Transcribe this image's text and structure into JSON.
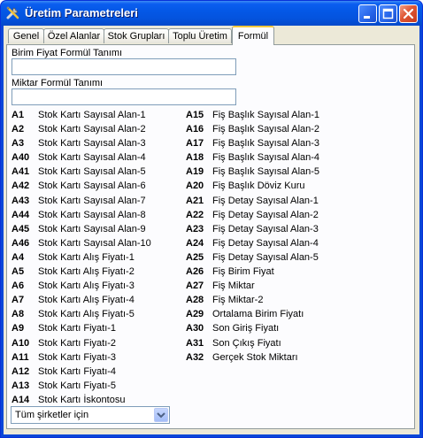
{
  "window": {
    "title": "Üretim Parametreleri",
    "app_icon": "tools-icon",
    "colors": {
      "titlebar": "#0458e6",
      "face": "#ece9d8",
      "tab_highlight": "#ffc83c",
      "close": "#df5633"
    }
  },
  "tabs": [
    {
      "label": "Genel"
    },
    {
      "label": "Özel Alanlar"
    },
    {
      "label": "Stok Grupları"
    },
    {
      "label": "Toplu Üretim"
    },
    {
      "label": "Formül",
      "active": true
    }
  ],
  "form": {
    "unit_price_label": "Birim Fiyat Formül Tanımı",
    "unit_price_value": "",
    "quantity_label": "Miktar Formül Tanımı",
    "quantity_value": ""
  },
  "left_codes": [
    {
      "code": "A1",
      "desc": "Stok Kartı Sayısal Alan-1"
    },
    {
      "code": "A2",
      "desc": "Stok Kartı Sayısal Alan-2"
    },
    {
      "code": "A3",
      "desc": "Stok Kartı Sayısal Alan-3"
    },
    {
      "code": "A40",
      "desc": "Stok Kartı Sayısal Alan-4"
    },
    {
      "code": "A41",
      "desc": "Stok Kartı Sayısal Alan-5"
    },
    {
      "code": "A42",
      "desc": "Stok Kartı Sayısal Alan-6"
    },
    {
      "code": "A43",
      "desc": "Stok Kartı Sayısal Alan-7"
    },
    {
      "code": "A44",
      "desc": "Stok Kartı Sayısal Alan-8"
    },
    {
      "code": "A45",
      "desc": "Stok Kartı Sayısal Alan-9"
    },
    {
      "code": "A46",
      "desc": "Stok Kartı Sayısal Alan-10"
    },
    {
      "code": "A4",
      "desc": "Stok Kartı Alış Fiyatı-1"
    },
    {
      "code": "A5",
      "desc": "Stok Kartı Alış Fiyatı-2"
    },
    {
      "code": "A6",
      "desc": "Stok Kartı Alış Fiyatı-3"
    },
    {
      "code": "A7",
      "desc": "Stok Kartı Alış Fiyatı-4"
    },
    {
      "code": "A8",
      "desc": "Stok Kartı Alış Fiyatı-5"
    },
    {
      "code": "A9",
      "desc": "Stok Kartı Fiyatı-1"
    },
    {
      "code": "A10",
      "desc": "Stok Kartı Fiyatı-2"
    },
    {
      "code": "A11",
      "desc": "Stok Kartı Fiyatı-3"
    },
    {
      "code": "A12",
      "desc": "Stok Kartı Fiyatı-4"
    },
    {
      "code": "A13",
      "desc": "Stok Kartı Fiyatı-5"
    },
    {
      "code": "A14",
      "desc": "Stok Kartı İskontosu"
    }
  ],
  "right_codes": [
    {
      "code": "A15",
      "desc": "Fiş Başlık Sayısal Alan-1"
    },
    {
      "code": "A16",
      "desc": "Fiş Başlık Sayısal Alan-2"
    },
    {
      "code": "A17",
      "desc": "Fiş Başlık Sayısal Alan-3"
    },
    {
      "code": "A18",
      "desc": "Fiş Başlık Sayısal Alan-4"
    },
    {
      "code": "A19",
      "desc": "Fiş Başlık Sayısal Alan-5"
    },
    {
      "code": "A20",
      "desc": "Fiş Başlık Döviz Kuru"
    },
    {
      "code": "A21",
      "desc": "Fiş Detay Sayısal Alan-1"
    },
    {
      "code": "A22",
      "desc": "Fiş Detay Sayısal Alan-2"
    },
    {
      "code": "A23",
      "desc": "Fiş Detay Sayısal Alan-3"
    },
    {
      "code": "A24",
      "desc": "Fiş Detay Sayısal Alan-4"
    },
    {
      "code": "A25",
      "desc": "Fiş Detay Sayısal Alan-5"
    },
    {
      "code": "A26",
      "desc": "Fiş Birim Fiyat"
    },
    {
      "code": "A27",
      "desc": "Fiş Miktar"
    },
    {
      "code": "A28",
      "desc": "Fiş Miktar-2"
    },
    {
      "code": "A29",
      "desc": "Ortalama Birim Fiyatı"
    },
    {
      "code": "A30",
      "desc": "Son Giriş Fiyatı"
    },
    {
      "code": "A31",
      "desc": "Son Çıkış Fiyatı"
    },
    {
      "code": "A32",
      "desc": "Gerçek Stok Miktarı"
    }
  ],
  "company_select": {
    "value": "Tüm şirketler için"
  }
}
